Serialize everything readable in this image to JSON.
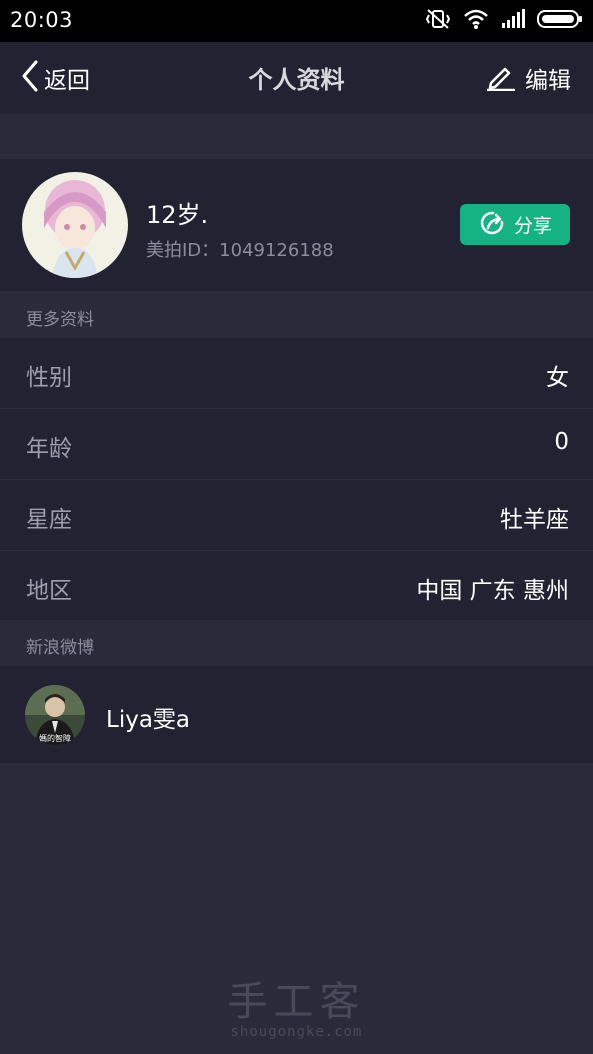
{
  "status_bar": {
    "time": "20:03",
    "icons": [
      "vibrate-off-icon",
      "wifi-icon",
      "signal-icon",
      "battery-icon"
    ]
  },
  "nav": {
    "back_label": "返回",
    "title": "个人资料",
    "edit_label": "编辑"
  },
  "profile": {
    "name": "12岁.",
    "id_text": "美拍ID：1049126188",
    "share_label": "分享"
  },
  "more_info": {
    "header": "更多资料",
    "rows": [
      {
        "label": "性别",
        "value": "女"
      },
      {
        "label": "年龄",
        "value": "0"
      },
      {
        "label": "星座",
        "value": "牡羊座"
      },
      {
        "label": "地区",
        "value": "中国 广东 惠州"
      }
    ]
  },
  "weibo": {
    "header": "新浪微博",
    "name": "Liya雯a",
    "avatar_caption": "媽的智障"
  },
  "watermark": {
    "cn": "手工客",
    "url": "shougongke.com"
  },
  "colors": {
    "background": "#2b2a3a",
    "card": "#232232",
    "accent": "#15b383",
    "muted_text": "#8d8c9a"
  }
}
